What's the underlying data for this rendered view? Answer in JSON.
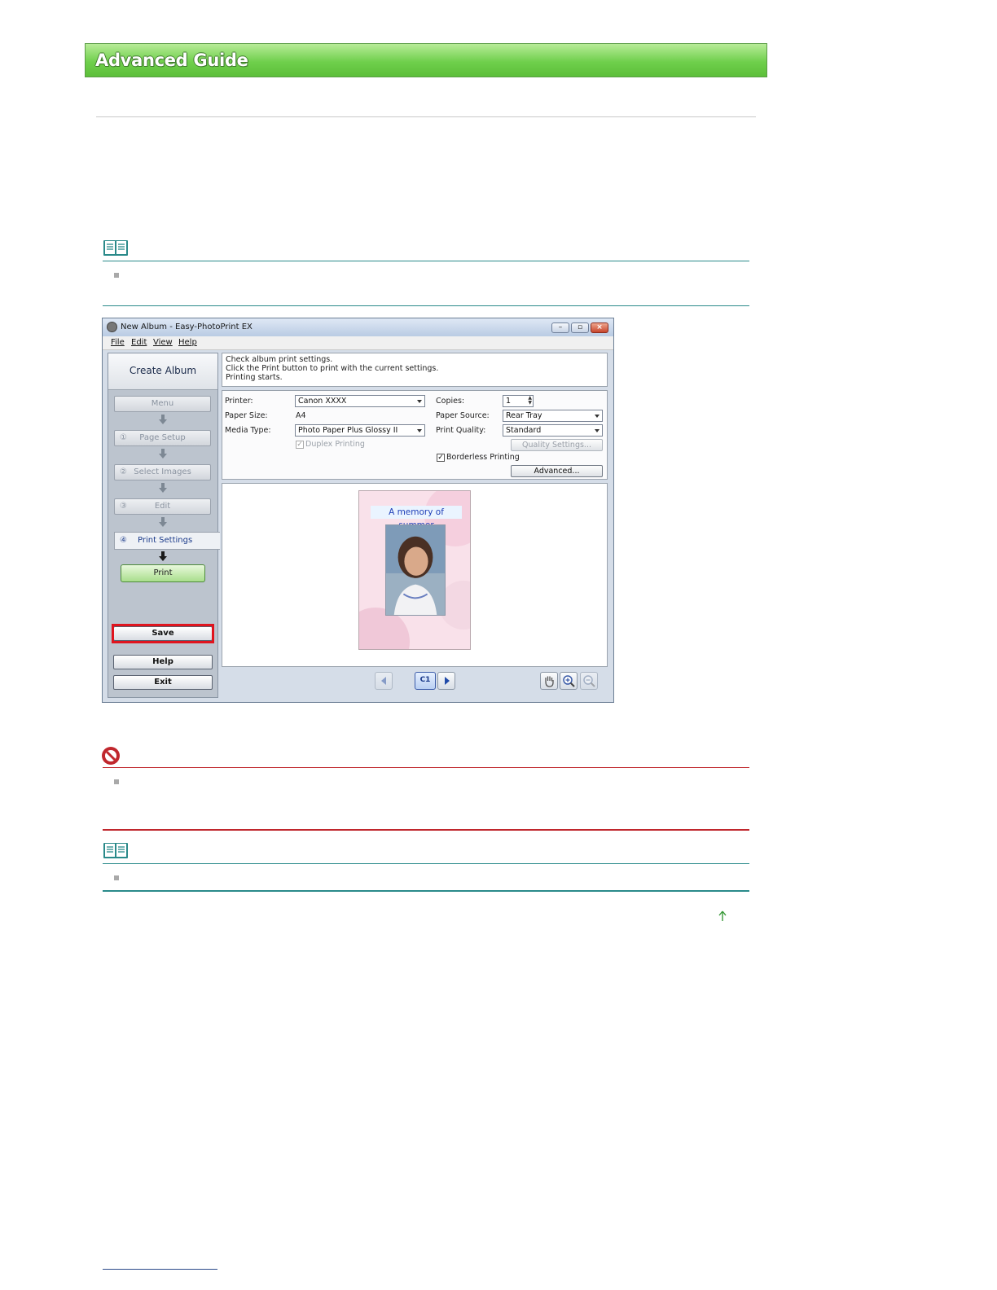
{
  "header": {
    "banner_title": "Advanced Guide"
  },
  "colors": {
    "banner_green": "#6fcf4c",
    "note_teal": "#2a8a8a",
    "caution_red": "#c0272d",
    "save_highlight": "#e0141e"
  },
  "screenshot": {
    "window_title": "New Album - Easy-PhotoPrint EX",
    "menu": [
      "File",
      "Edit",
      "View",
      "Help"
    ],
    "left_panel": {
      "heading": "Create Album",
      "menu_button": "Menu",
      "steps": [
        {
          "num": "①",
          "label": "Page Setup"
        },
        {
          "num": "②",
          "label": "Select Images"
        },
        {
          "num": "③",
          "label": "Edit"
        },
        {
          "num": "④",
          "label": "Print Settings"
        }
      ],
      "print_button": "Print",
      "save_button": "Save",
      "help_button": "Help",
      "exit_button": "Exit"
    },
    "instructions": [
      "Check album print settings.",
      "Click the Print button to print with the current settings.",
      "Printing starts."
    ],
    "settings": {
      "printer_label": "Printer:",
      "printer_value": "Canon XXXX",
      "paper_size_label": "Paper Size:",
      "paper_size_value": "A4",
      "media_type_label": "Media Type:",
      "media_type_value": "Photo Paper Plus Glossy II",
      "duplex_label": "Duplex Printing",
      "copies_label": "Copies:",
      "copies_value": "1",
      "paper_source_label": "Paper Source:",
      "paper_source_value": "Rear Tray",
      "print_quality_label": "Print Quality:",
      "print_quality_value": "Standard",
      "quality_settings_button": "Quality Settings...",
      "borderless_label": "Borderless Printing",
      "advanced_button": "Advanced..."
    },
    "preview": {
      "album_title": "A memory of summer"
    },
    "toolbar": {
      "page_indicator": "C1"
    }
  }
}
